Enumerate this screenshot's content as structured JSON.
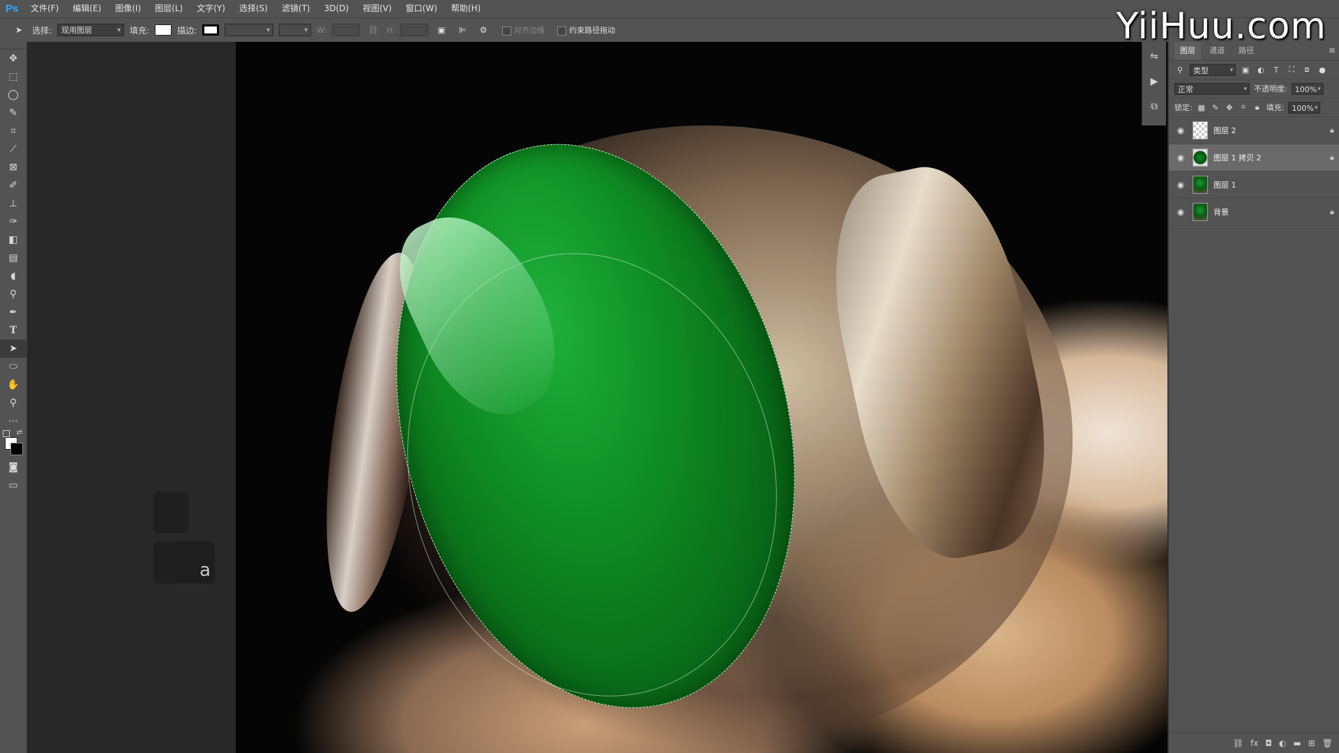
{
  "app": {
    "logo": "Ps",
    "menu": [
      "文件(F)",
      "编辑(E)",
      "图像(I)",
      "图层(L)",
      "文字(Y)",
      "选择(S)",
      "滤镜(T)",
      "3D(D)",
      "视图(V)",
      "窗口(W)",
      "帮助(H)"
    ]
  },
  "options": {
    "select_label": "选择:",
    "select_value": "现用图层",
    "fill_label": "填充:",
    "stroke_label": "描边:",
    "w_label": "W:",
    "h_label": "H:",
    "align_edges_label": "对齐边缘",
    "constrain_path_label": "约束路径拖动",
    "fill_color": "#ffffff",
    "stroke_color": "#000000"
  },
  "watermark": "YiiHuu.com",
  "keystrokes": {
    "key_a": "a"
  },
  "layers_panel": {
    "tabs": [
      "图层",
      "通道",
      "路径"
    ],
    "filter_kind": "类型",
    "blend_mode": "正常",
    "opacity_label": "不透明度:",
    "opacity_value": "100%",
    "lock_label": "锁定:",
    "fill_label": "填充:",
    "fill_value": "100%",
    "layers": [
      {
        "name": "图层 2",
        "thumb": "transparent",
        "visible": true,
        "locked": true,
        "selected": false
      },
      {
        "name": "图层 1 拷贝 2",
        "thumb": "jade",
        "visible": true,
        "locked": true,
        "selected": true
      },
      {
        "name": "图层 1",
        "thumb": "photo",
        "visible": true,
        "locked": false,
        "selected": false
      },
      {
        "name": "背景",
        "thumb": "photo",
        "visible": true,
        "locked": true,
        "selected": false
      }
    ]
  }
}
